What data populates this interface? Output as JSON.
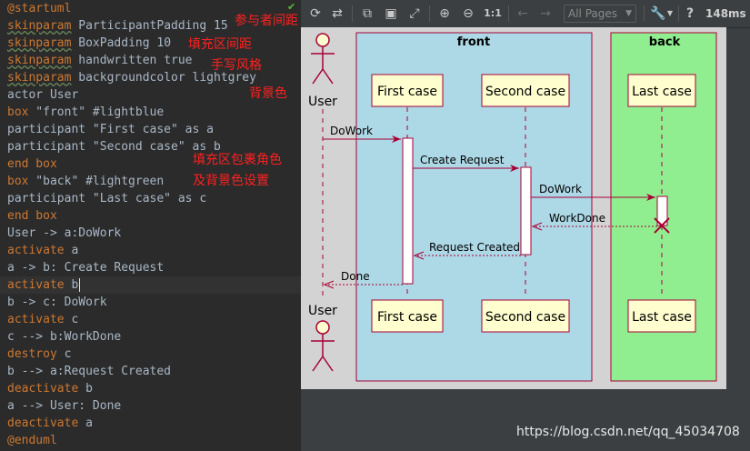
{
  "editor": {
    "lines": [
      [
        {
          "t": "@startuml",
          "c": "kw"
        }
      ],
      [
        {
          "t": "skinparam",
          "c": "sk"
        },
        {
          "t": " ParticipantPadding 15"
        }
      ],
      [
        {
          "t": "skinparam",
          "c": "sk"
        },
        {
          "t": " BoxPadding 10"
        }
      ],
      [
        {
          "t": "skinparam",
          "c": "sk"
        },
        {
          "t": " handwritten true"
        }
      ],
      [
        {
          "t": "skinparam",
          "c": "sk"
        },
        {
          "t": " backgroundcolor lightgrey"
        }
      ],
      [
        {
          "t": "actor User"
        }
      ],
      [
        {
          "t": "box",
          "c": "kw"
        },
        {
          "t": " \"front\" #lightblue"
        }
      ],
      [
        {
          "t": "participant \"First case\" as a"
        }
      ],
      [
        {
          "t": "participant \"Second case\" as b"
        }
      ],
      [
        {
          "t": "end box",
          "c": "kw"
        }
      ],
      [
        {
          "t": "box",
          "c": "kw"
        },
        {
          "t": " \"back\" #lightgreen"
        }
      ],
      [
        {
          "t": "participant \"Last case\" as c"
        }
      ],
      [
        {
          "t": "end box",
          "c": "kw"
        }
      ],
      [
        {
          "t": "User -> a:DoWork"
        }
      ],
      [
        {
          "t": "activate",
          "c": "kw"
        },
        {
          "t": " a"
        }
      ],
      [
        {
          "t": "a -> b: Create Request"
        }
      ],
      [
        {
          "t": "activate",
          "c": "kw"
        },
        {
          "t": " b"
        }
      ],
      [
        {
          "t": "b -> c: DoWork"
        }
      ],
      [
        {
          "t": "activate",
          "c": "kw"
        },
        {
          "t": " c"
        }
      ],
      [
        {
          "t": "c --> b:WorkDone"
        }
      ],
      [
        {
          "t": "destroy",
          "c": "kw"
        },
        {
          "t": " c"
        }
      ],
      [
        {
          "t": "b --> a:Request Created"
        }
      ],
      [
        {
          "t": "deactivate",
          "c": "kw"
        },
        {
          "t": " b"
        }
      ],
      [
        {
          "t": "a --> User: Done"
        }
      ],
      [
        {
          "t": "deactivate",
          "c": "kw"
        },
        {
          "t": " a"
        }
      ],
      [
        {
          "t": "@enduml",
          "c": "kw"
        }
      ]
    ],
    "current_line": 16
  },
  "annotations": {
    "participant_padding": "参与者间距",
    "box_padding": "填充区间距",
    "handwritten": "手写风格",
    "background": "背景色",
    "box_desc_1": "填充区包裹角色",
    "box_desc_2": "及背景色设置"
  },
  "toolbar": {
    "zoom_actual": "1:1",
    "pages_select": "All Pages",
    "timing": "148ms"
  },
  "diagram": {
    "background": "#d3d3d3",
    "boxes": [
      {
        "title": "front",
        "color": "#add8e6"
      },
      {
        "title": "back",
        "color": "#90ee90"
      }
    ],
    "actor": "User",
    "participants": [
      "First case",
      "Second case",
      "Last case"
    ],
    "messages": [
      "DoWork",
      "Create Request",
      "DoWork",
      "WorkDone",
      "Request Created",
      "Done"
    ]
  },
  "watermark": "https://blog.csdn.net/qq_45034708",
  "colors": {
    "annotation": "#ff2020",
    "arrow": "#a80036",
    "participant_fill": "#fefece"
  }
}
